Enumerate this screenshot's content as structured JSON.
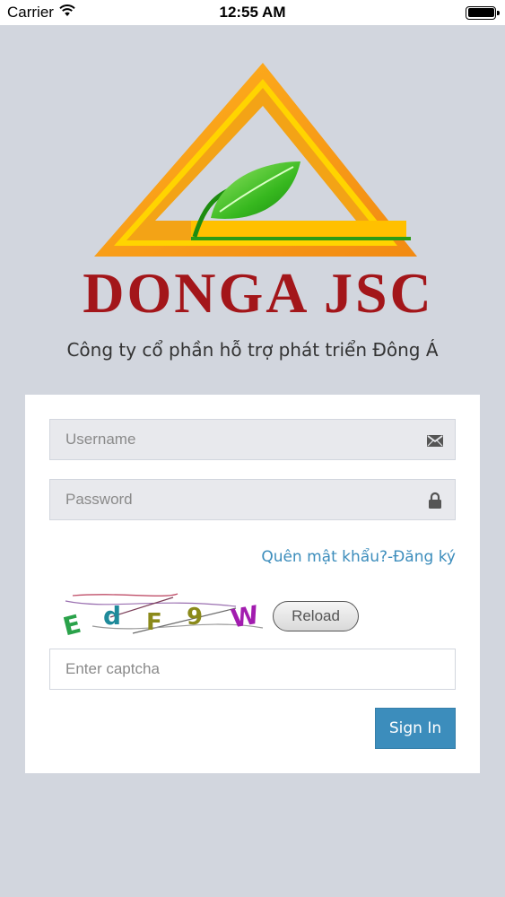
{
  "status_bar": {
    "carrier": "Carrier",
    "time": "12:55 AM",
    "icons": [
      "wifi-icon",
      "battery-icon"
    ]
  },
  "logo": {
    "text": "DONGA JSC",
    "colors": {
      "triangle_outer": "#f7941d",
      "triangle_inner": "#ffd400",
      "leaf": "#3cb521",
      "text": "#a3161a"
    }
  },
  "tagline": "Công ty cổ phần hỗ trợ phát triển Đông Á",
  "form": {
    "username": {
      "value": "",
      "placeholder": "Username",
      "icon": "envelope-icon"
    },
    "password": {
      "value": "",
      "placeholder": "Password",
      "icon": "lock-icon"
    },
    "forgot_password": "Quên mật khẩu?",
    "register": "-Đăng ký",
    "captcha": {
      "characters": [
        "E",
        "d",
        "F",
        "9",
        "W"
      ],
      "reload_label": "Reload"
    },
    "captcha_input": {
      "value": "",
      "placeholder": "Enter captcha"
    },
    "signin_label": "Sign In"
  },
  "colors": {
    "background": "#d2d6de",
    "accent": "#3c8dbc",
    "card": "#ffffff"
  }
}
